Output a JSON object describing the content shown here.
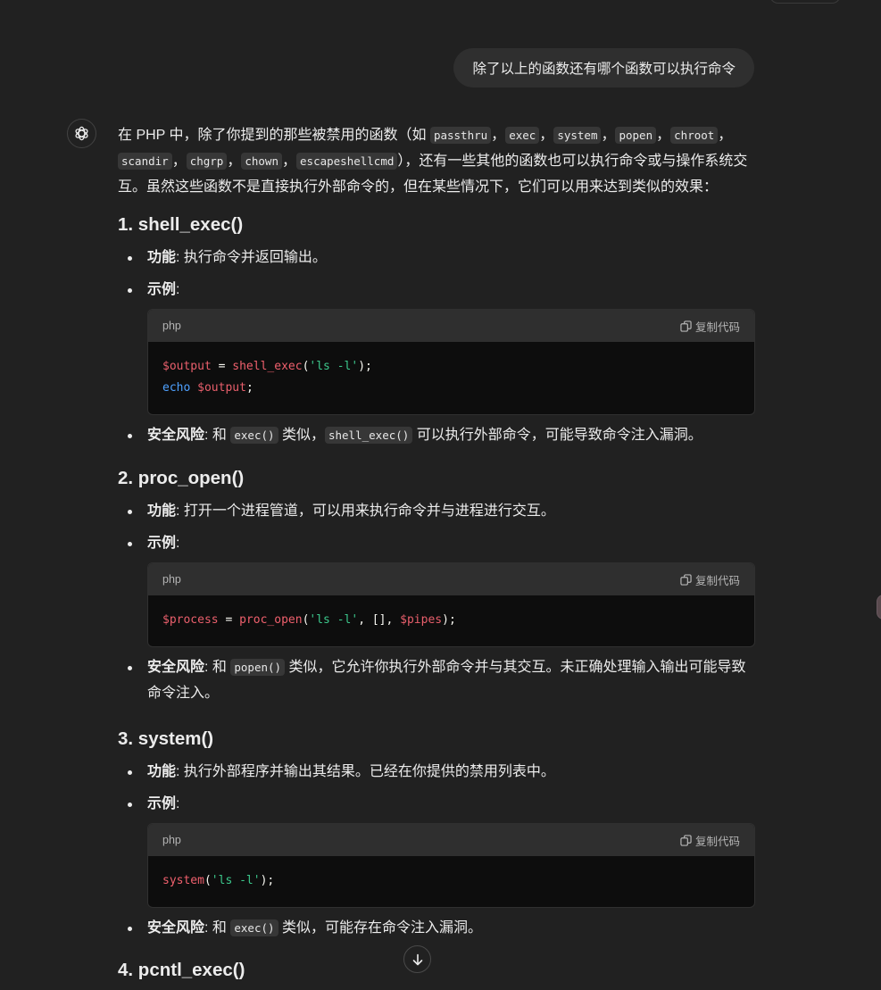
{
  "user_message": "除了以上的函数还有哪个函数可以执行命令",
  "intro": {
    "prefix": "在 PHP 中，除了你提到的那些被禁用的函数（如 ",
    "codes": [
      "passthru",
      "exec",
      "system",
      "popen",
      "chroot",
      "scandir",
      "chgrp",
      "chown",
      "escapeshellcmd"
    ],
    "sep": "，",
    "suffix": "），还有一些其他的函数也可以执行命令或与操作系统交互。虽然这些函数不是直接执行外部命令的，但在某些情况下，它们可以用来达到类似的效果："
  },
  "labels": {
    "func": "功能",
    "example": "示例",
    "risk": "安全风险",
    "colon": ":"
  },
  "code_lang": "php",
  "copy_label": "复制代码",
  "sections": [
    {
      "heading": "1. shell_exec()",
      "func_text": " 执行命令并返回输出。",
      "risk_pre": " 和 ",
      "risk_code1": "exec()",
      "risk_mid": " 类似，",
      "risk_code2": "shell_exec()",
      "risk_post": " 可以执行外部命令，可能导致命令注入漏洞。"
    },
    {
      "heading": "2. proc_open()",
      "func_text": " 打开一个进程管道，可以用来执行命令并与进程进行交互。",
      "risk_pre": " 和 ",
      "risk_code1": "popen()",
      "risk_post": " 类似，它允许你执行外部命令并与其交互。未正确处理输入输出可能导致命令注入。"
    },
    {
      "heading": "3. system()",
      "func_text": " 执行外部程序并输出其结果。已经在你提供的禁用列表中。",
      "risk_pre": " 和 ",
      "risk_code1": "exec()",
      "risk_post": " 类似，可能存在命令注入漏洞。"
    },
    {
      "heading": "4. pcntl_exec()"
    }
  ]
}
